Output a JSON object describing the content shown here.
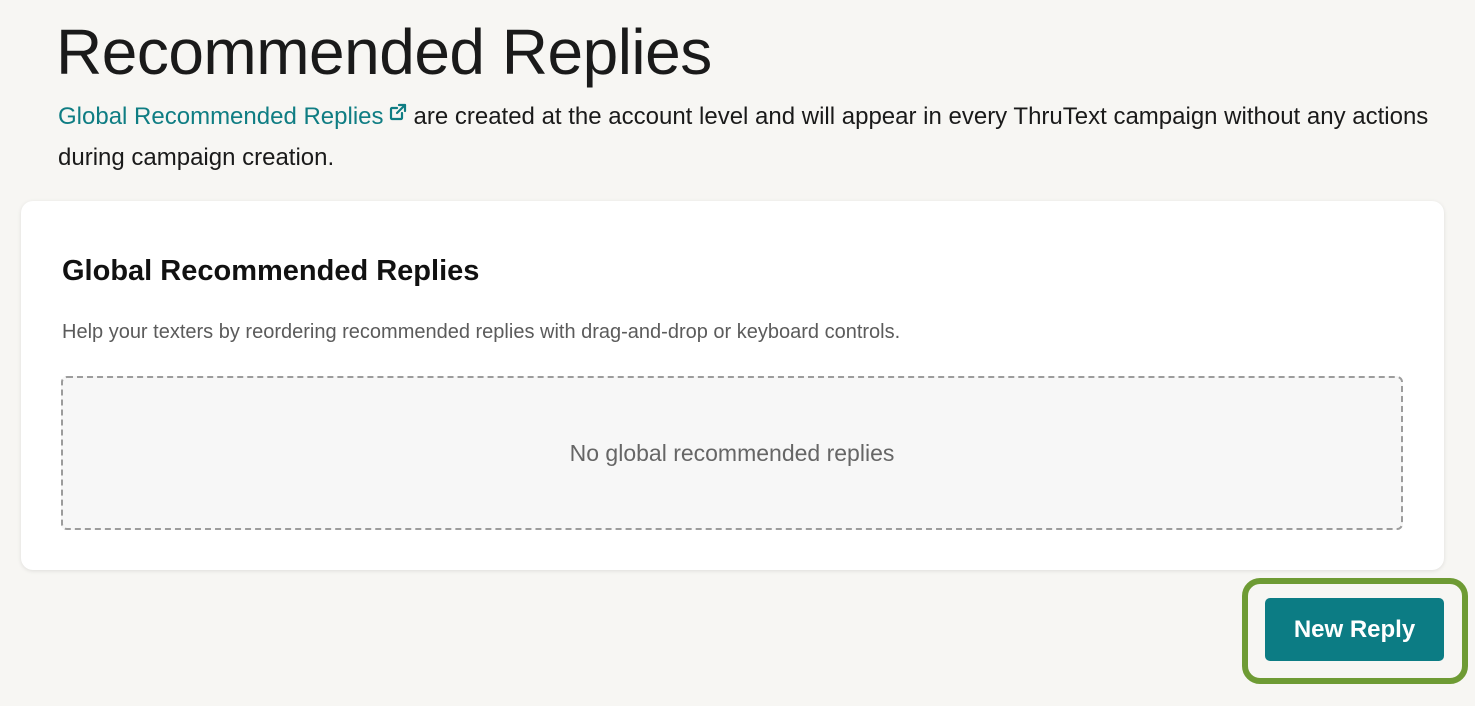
{
  "page": {
    "title": "Recommended Replies",
    "intro_link": "Global Recommended Replies",
    "intro_text": "are created at the account level and will appear in every ThruText campaign without any actions during campaign creation."
  },
  "icons": {
    "external_link": "external-link-icon"
  },
  "colors": {
    "accent": "#0c7c84",
    "link": "#0f7d83",
    "focus_ring": "#6e9b34",
    "background": "#f7f6f3"
  },
  "card": {
    "title": "Global Recommended Replies",
    "description": "Help your texters by reordering recommended replies with drag-and-drop or keyboard controls.",
    "empty_message": "No global recommended replies"
  },
  "actions": {
    "new_reply_label": "New Reply"
  }
}
